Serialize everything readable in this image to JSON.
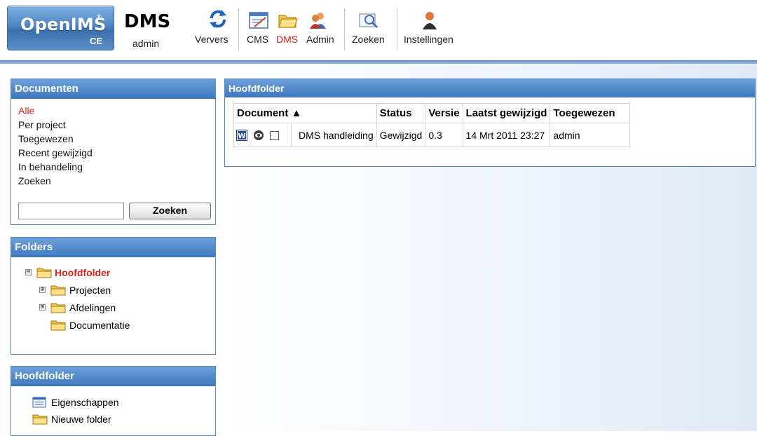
{
  "logo": {
    "name": "OpenIMS",
    "edition": "CE",
    "registered": "®"
  },
  "app": {
    "title": "DMS",
    "user": "admin"
  },
  "toolbar": {
    "refresh": "Ververs",
    "cms": "CMS",
    "dms": "DMS",
    "admin": "Admin",
    "search": "Zoeken",
    "settings": "Instellingen"
  },
  "colors": {
    "accent": "#3c78c0",
    "active": "#e0201b",
    "panel_border": "#4f86c8"
  },
  "documents_panel": {
    "title": "Documenten",
    "links": [
      "Alle",
      "Per project",
      "Toegewezen",
      "Recent gewijzigd",
      "In behandeling",
      "Zoeken"
    ],
    "search_value": "",
    "search_button": "Zoeken"
  },
  "folders_panel": {
    "title": "Folders",
    "root": "Hoofdfolder",
    "children": [
      "Projecten",
      "Afdelingen",
      "Documentatie"
    ],
    "expanders": {
      "root": "⊟",
      "collapsed": "⊞"
    }
  },
  "folder_actions_panel": {
    "title": "Hoofdfolder",
    "actions": [
      "Eigenschappen",
      "Nieuwe folder"
    ]
  },
  "main_panel": {
    "title": "Hoofdfolder",
    "columns": [
      "Document ▲",
      "Status",
      "Versie",
      "Laatst gewijzigd",
      "Toegewezen"
    ],
    "rows": [
      {
        "icon": "word-document-icon",
        "name": "DMS handleiding",
        "status": "Gewijzigd",
        "version": "0.3",
        "modified": "14 Mrt 2011 23:27",
        "assigned": "admin"
      }
    ]
  }
}
